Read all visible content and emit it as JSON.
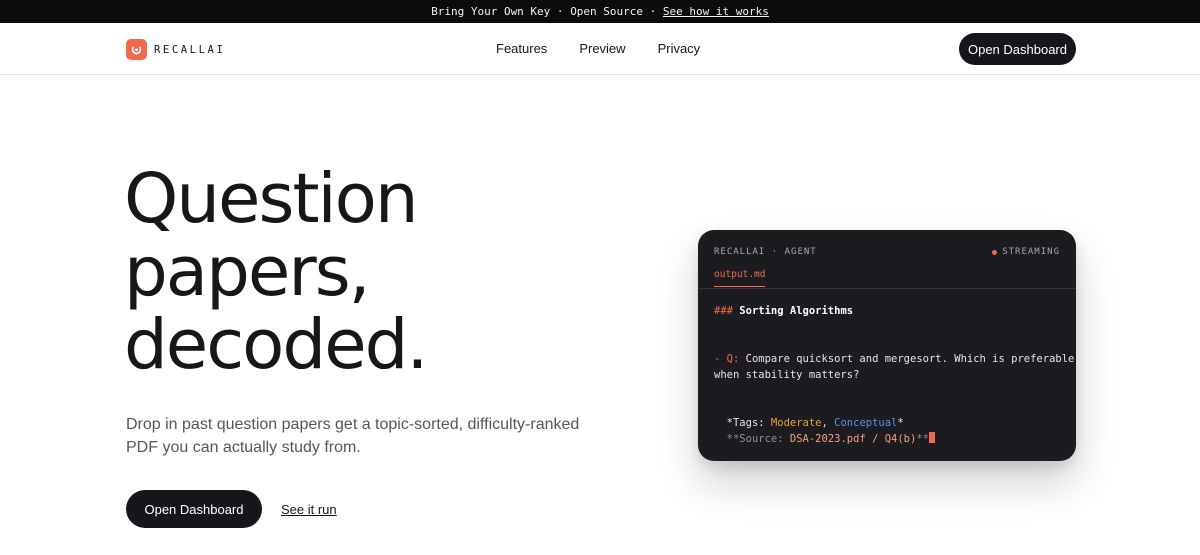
{
  "announcement": {
    "byok": "Bring Your Own Key",
    "sep": " · ",
    "open_source": "Open Source",
    "link": "See how it works"
  },
  "nav": {
    "brand": "RECALLAI",
    "links": [
      "Features",
      "Preview",
      "Privacy"
    ],
    "cta": "Open Dashboard"
  },
  "hero": {
    "title_lines": [
      "Question",
      "papers,",
      "decoded."
    ],
    "subtitle_lines": [
      "Drop in past question papers get a topic-sorted, difficulty-ranked",
      "PDF you can actually study from."
    ],
    "primary_cta": "Open Dashboard",
    "secondary_cta": "See it run"
  },
  "terminal": {
    "header": "RECALLAI · AGENT",
    "status": "STREAMING",
    "tab": "output.md",
    "heading_marker": "###",
    "heading": "Sorting Algorithms",
    "bullet": "-",
    "q_label": "Q:",
    "question_line1": "Compare quicksort and mergesort. Which is preferable",
    "question_line2": "when stability matters?",
    "tags_prefix": "*Tags:",
    "tag_difficulty": "Moderate",
    "tag_comma": ",",
    "tag_type": "Conceptual",
    "tags_suffix": "*",
    "source_prefix": "**Source:",
    "source_value": "DSA-2023.pdf / Q4(b)",
    "source_suffix": "**"
  },
  "colors": {
    "accent": "#ee6b4d",
    "dark": "#17171b",
    "terminal_bg": "#1c1b1f",
    "tag_moderate": "#e5a13f",
    "tag_conceptual": "#5b8ef0"
  }
}
